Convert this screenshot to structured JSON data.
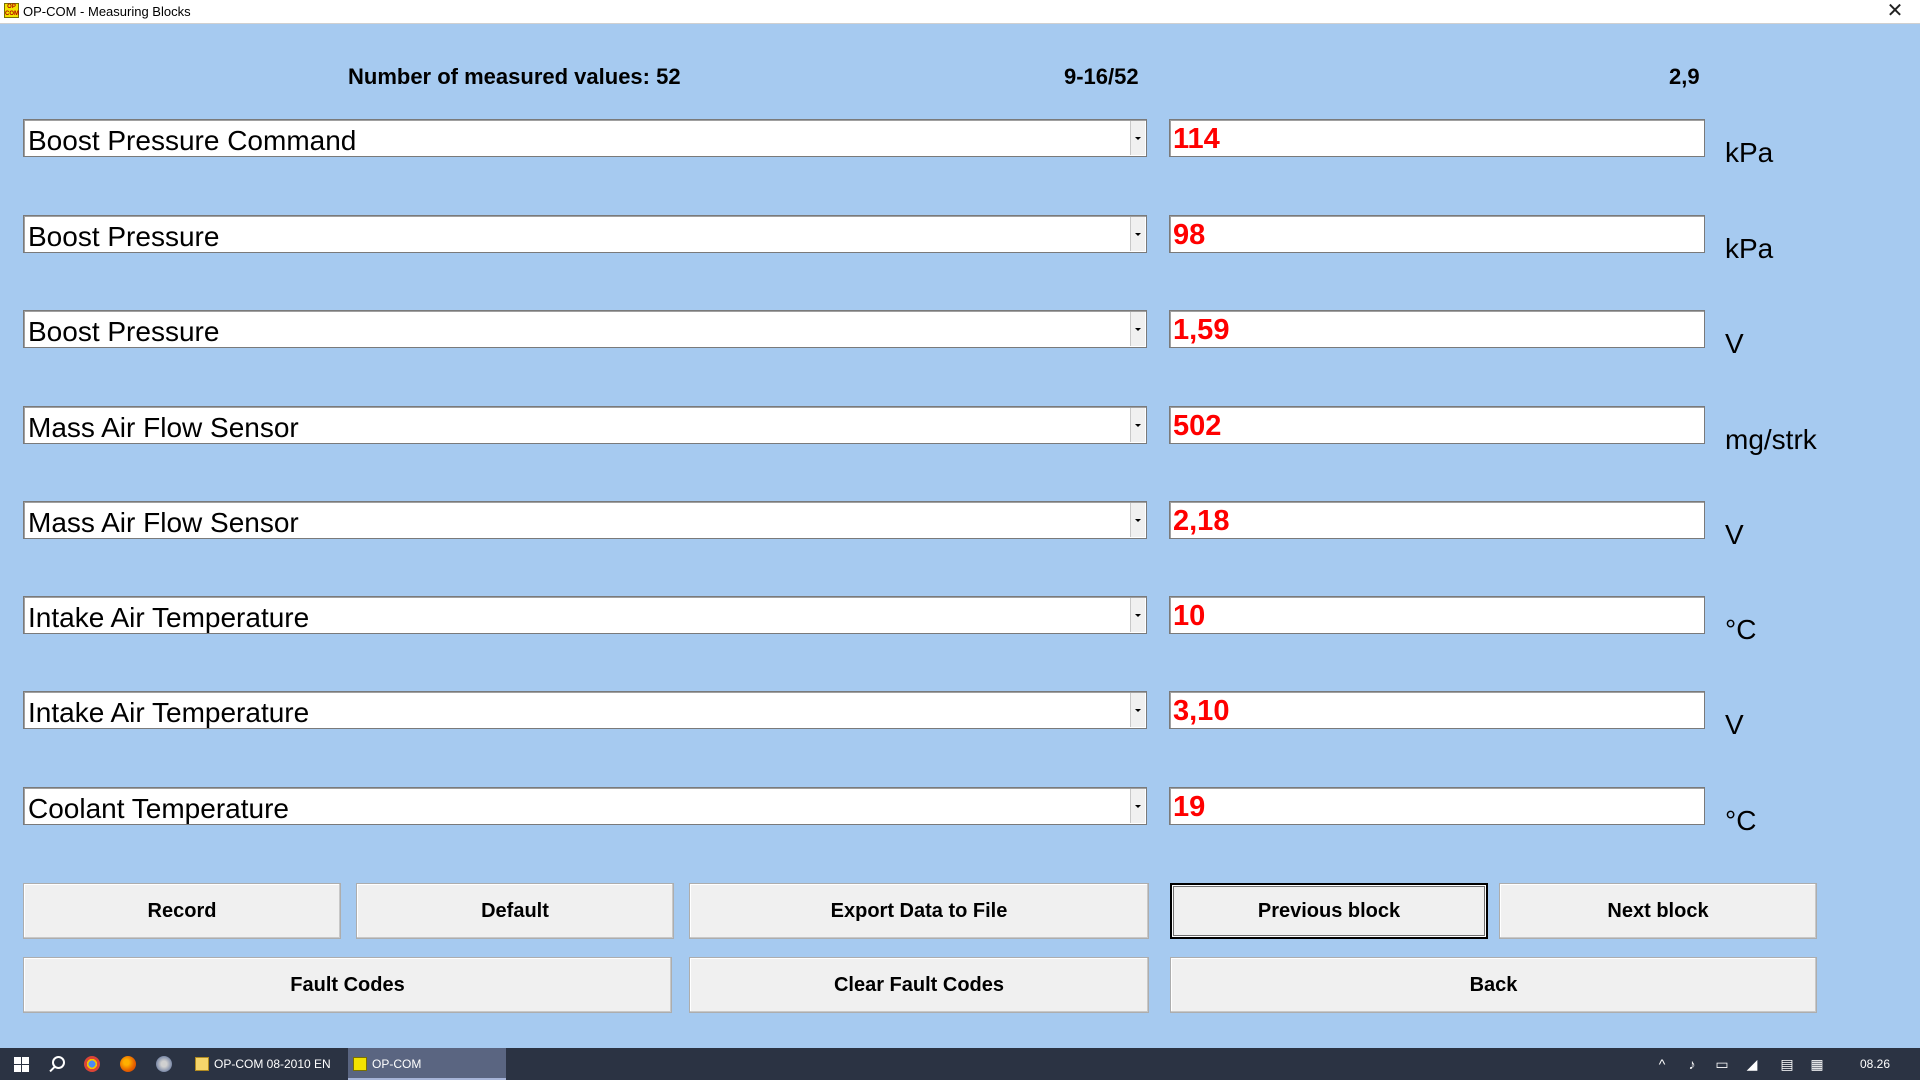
{
  "window": {
    "app_icon": "op-com-icon",
    "title": "OP-COM - Measuring Blocks",
    "close_glyph": "✕"
  },
  "header": {
    "count_label": "Number of measured values: 52",
    "range": "9-16/52",
    "rate": "2,9"
  },
  "rows": [
    {
      "name": "Boost Pressure Command",
      "value": "114",
      "unit": "kPa"
    },
    {
      "name": "Boost Pressure",
      "value": "98",
      "unit": "kPa"
    },
    {
      "name": "Boost Pressure",
      "value": "1,59",
      "unit": "V"
    },
    {
      "name": "Mass Air Flow Sensor",
      "value": "502",
      "unit": "mg/strk"
    },
    {
      "name": "Mass Air Flow Sensor",
      "value": "2,18",
      "unit": "V"
    },
    {
      "name": "Intake Air Temperature",
      "value": "10",
      "unit": "°C"
    },
    {
      "name": "Intake Air Temperature",
      "value": "3,10",
      "unit": "V"
    },
    {
      "name": "Coolant Temperature",
      "value": "19",
      "unit": "°C"
    }
  ],
  "buttons": {
    "record": "Record",
    "default": "Default",
    "export": "Export Data to File",
    "previous": "Previous block",
    "next": "Next block",
    "fault_codes": "Fault Codes",
    "clear_fault_codes": "Clear Fault Codes",
    "back": "Back"
  },
  "taskbar": {
    "tasks": [
      "OP-COM 08-2010 EN",
      "OP-COM"
    ],
    "clock": "08.26",
    "colors": {
      "background": "#2B3343",
      "active_task": "#5A6581"
    }
  },
  "colors": {
    "window_background": "#A6CAF0",
    "value_text": "#FF0000",
    "button_face": "#F0F0F0"
  }
}
